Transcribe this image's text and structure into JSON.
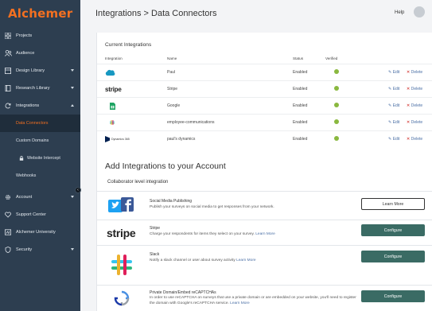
{
  "brand": {
    "name": "Alchemer",
    "color": "#f37021"
  },
  "sidebar": {
    "items": [
      {
        "label": "Projects",
        "icon": "grid-icon"
      },
      {
        "label": "Audience",
        "icon": "people-icon"
      },
      {
        "label": "Design Library",
        "icon": "design-icon",
        "caret": "down"
      },
      {
        "label": "Research Library",
        "icon": "book-icon",
        "caret": "down"
      },
      {
        "label": "Integrations",
        "icon": "refresh-icon",
        "caret": "up"
      }
    ],
    "sub_items": [
      {
        "label": "Data Connectors",
        "active": true
      },
      {
        "label": "Custom Domains"
      },
      {
        "label": "Website Intercept",
        "lock": true
      },
      {
        "label": "Webhooks"
      }
    ],
    "bottom_items": [
      {
        "label": "Account",
        "icon": "gear-icon",
        "caret": "down"
      },
      {
        "label": "Support Center",
        "icon": "heart-icon"
      },
      {
        "label": "Alchemer University",
        "icon": "university-icon"
      },
      {
        "label": "Security",
        "icon": "shield-icon",
        "caret": "down"
      }
    ]
  },
  "header": {
    "title": "Integrations > Data Connectors",
    "help": "Help"
  },
  "current": {
    "title": "Current Integrations",
    "columns": {
      "integration": "Integration",
      "name": "Name",
      "status": "Status",
      "verified": "Verified"
    },
    "rows": [
      {
        "logo": "salesforce-logo",
        "name": "Paul",
        "status": "Enabled",
        "edit": "Edit",
        "delete": "Delete"
      },
      {
        "logo": "stripe-logo",
        "logo_text": "stripe",
        "name": "Stripe",
        "status": "Enabled",
        "edit": "Edit",
        "delete": "Delete"
      },
      {
        "logo": "google-sheets-logo",
        "name": "Google",
        "status": "Enabled",
        "edit": "Edit",
        "delete": "Delete"
      },
      {
        "logo": "slack-logo",
        "name": "employee-communications",
        "status": "Enabled",
        "edit": "Edit",
        "delete": "Delete"
      },
      {
        "logo": "dynamics-logo",
        "logo_text": "Dynamics 365",
        "name": "paul's dynamics",
        "status": "Enabled",
        "edit": "Edit",
        "delete": "Delete"
      }
    ]
  },
  "add": {
    "title": "Add Integrations to your Account",
    "collab_label": "Collaborator level integration",
    "cards": [
      {
        "logo": "twitter-facebook-logo",
        "title": "Social Media Publishing",
        "desc": "Publish your surveys on social media to get responses from your network.",
        "link": "",
        "button": "Learn More"
      },
      {
        "logo": "stripe-logo",
        "logo_text": "stripe",
        "title": "Stripe",
        "desc": "Charge your respondents for items they select on your survey.",
        "link": "Learn More",
        "button": "Configure"
      },
      {
        "logo": "slack-logo",
        "title": "Slack",
        "desc": "Notify a slack channel or user about survey activity",
        "link": "Learn More",
        "button": "Configure"
      },
      {
        "logo": "recaptcha-logo",
        "title": "Private Domain/Embed reCAPTCHAs",
        "desc": "In order to use reCAPTCHA on surveys that use a private domain or are embedded on your website, you'll need to register the domain with Google's reCAPTCHA service.",
        "link": "Learn More",
        "button": "Configure"
      }
    ]
  },
  "colors": {
    "sidebar": "#2d3e50",
    "accent": "#f37021",
    "button": "#3a6b64",
    "verified": "#8ab83f"
  }
}
